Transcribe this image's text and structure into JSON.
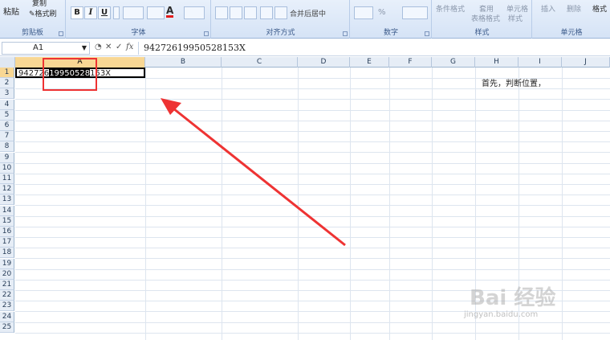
{
  "ribbon": {
    "clipboard": {
      "paste": "粘贴",
      "copy": "复制",
      "format_painter": "格式刷",
      "label": "剪贴板"
    },
    "font": {
      "bold": "B",
      "italic": "I",
      "underline": "U",
      "font_color": "A",
      "label": "字体"
    },
    "alignment": {
      "merge_center": "合并后居中",
      "label": "对齐方式"
    },
    "number": {
      "percent": "%",
      "label": "数字"
    },
    "styles": {
      "conditional": "条件格式",
      "table_format_1": "套用",
      "table_format_2": "表格格式",
      "cell_styles_1": "单元格",
      "cell_styles_2": "样式",
      "label": "样式"
    },
    "cells": {
      "insert": "插入",
      "delete": "删除",
      "format": "格式",
      "label": "单元格"
    }
  },
  "formula_bar": {
    "name_box": "A1",
    "fx": "fx",
    "content": "94272619950528153X"
  },
  "columns": [
    "A",
    "B",
    "C",
    "D",
    "E",
    "F",
    "G",
    "H",
    "I",
    "J"
  ],
  "rows": [
    "1",
    "2",
    "3",
    "4",
    "5",
    "6",
    "7",
    "8",
    "9",
    "10",
    "11",
    "12",
    "13",
    "14",
    "15",
    "16",
    "17",
    "18",
    "19",
    "20",
    "21",
    "22",
    "23",
    "24",
    "25"
  ],
  "cell_a1": {
    "before": "942726",
    "selected": "19950528",
    "after": "153X"
  },
  "annotation": "首先，判断位置，",
  "watermark": {
    "brand": "Bai 经验",
    "url": "jingyan.baidu.com"
  }
}
